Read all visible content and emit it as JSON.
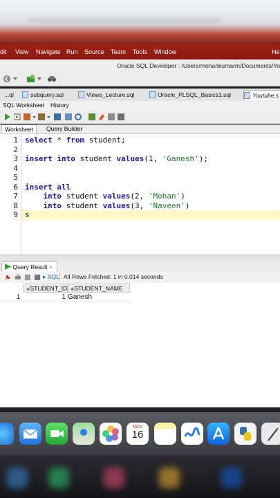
{
  "menu": {
    "items": [
      "dit",
      "View",
      "Navigate",
      "Run",
      "Source",
      "Team",
      "Tools",
      "Window",
      "Help"
    ]
  },
  "window": {
    "title": "Oracle SQL Developer : /Users/mohankumarm/Documents/Yo"
  },
  "tabs": [
    "...ql",
    "subquery.sql",
    "Views_Lecture.sql",
    "Oracle_PLSQL_Basics1.sql",
    "Youtube.s"
  ],
  "subtabs": {
    "worksheet": "SQL Worksheet",
    "history": "History"
  },
  "editor_tabs": {
    "worksheet": "Worksheet",
    "query_builder": "Query Builder"
  },
  "editor": {
    "line_numbers": [
      "1",
      "2",
      "3",
      "4",
      "5",
      "6",
      "7",
      "8",
      "9"
    ],
    "lines": [
      "select * from student;",
      "",
      "insert into student values(1, 'Ganesh');",
      "",
      "",
      "insert all",
      "    into student values(2, 'Mohan')",
      "    into student values(3, 'Naveen')",
      "s"
    ]
  },
  "results": {
    "tab_label": "Query Result",
    "sql_label": "SQL",
    "status": "All Rows Fetched: 1 in 0.014 seconds",
    "columns": [
      "STUDENT_ID",
      "STUDENT_NAME"
    ],
    "rows": [
      {
        "rownum": "1",
        "student_id": "1",
        "student_name": "Ganesh"
      }
    ]
  },
  "dock": {
    "calendar_month": "NOV",
    "calendar_day": "16"
  },
  "colors": {
    "menubar": "#9e1f14",
    "keyword": "#1a1aa6",
    "string": "#1f7a2c"
  }
}
